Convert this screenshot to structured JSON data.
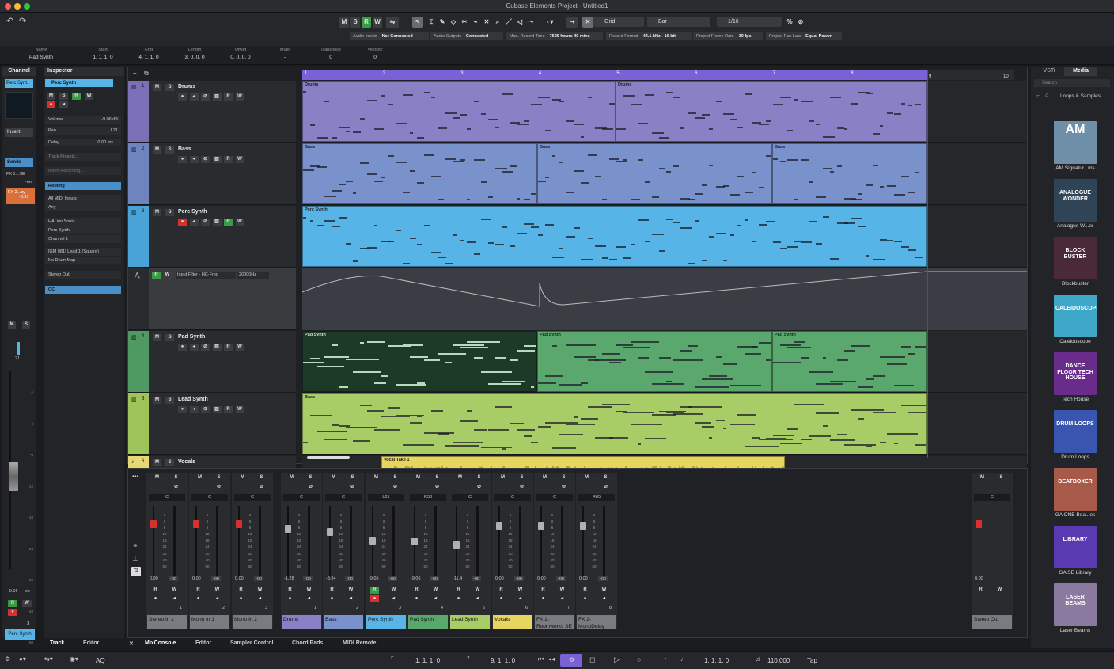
{
  "window": {
    "title": "Cubase Elements Project - Untitled1"
  },
  "toolbar": {
    "modes": [
      "M",
      "S",
      "R",
      "W"
    ],
    "grid_label": "Grid",
    "bar_label": "Bar",
    "quantize": "1/16",
    "status": [
      {
        "label": "Audio Inputs",
        "value": "Not Connected"
      },
      {
        "label": "Audio Outputs",
        "value": "Connected"
      },
      {
        "label": "Max. Record Time",
        "value": "7529 hours 49 mins"
      },
      {
        "label": "Record Format",
        "value": "44.1 kHz - 16 bit"
      },
      {
        "label": "Project Frame Rate",
        "value": "30 fps"
      },
      {
        "label": "Project Pan Law",
        "value": "Equal Power"
      }
    ]
  },
  "infoline": [
    {
      "label": "Name",
      "value": "Pad Synth"
    },
    {
      "label": "Start",
      "value": "1. 1. 1.   0"
    },
    {
      "label": "End",
      "value": "4. 1. 1.   0"
    },
    {
      "label": "Length",
      "value": "3. 0. 0.   0"
    },
    {
      "label": "Offset",
      "value": "0. 0. 0.   0"
    },
    {
      "label": "Mute",
      "value": "-"
    },
    {
      "label": "Transpose",
      "value": "0"
    },
    {
      "label": "Velocity",
      "value": "0"
    }
  ],
  "channel": {
    "title": "Channel",
    "name": "Perc Synt.",
    "insert": "Insert",
    "sends": "Sends",
    "send1": "FX 1...SE",
    "send1_val": "-oo",
    "send2": "FX 2...ay",
    "send2_val": "-8.31",
    "pan": "L21",
    "vol": "-9.06",
    "vol2": "-oo",
    "num": "3",
    "bottom_name": "Perc Synth",
    "scale": [
      "6",
      "0",
      "-6",
      "-12",
      "-18",
      "-24",
      "-30",
      "-40",
      "-50"
    ]
  },
  "inspector": {
    "title": "Inspector",
    "track": "Perc Synth",
    "volume_label": "Volume",
    "volume": "-9.06 dB",
    "pan_label": "Pan",
    "pan": "L21",
    "delay_label": "Delay",
    "delay": "0.00 ms",
    "presets": "Track Presets...",
    "insert_rec": "Insert Recording...",
    "routing": "Routing",
    "midi_in": "All MIDI Inputs",
    "any": "Any",
    "halion": "HALion Sonic",
    "perc": "Perc Synth",
    "chan": "Channel 1",
    "program": "[GM 081] Lead 1 (Square)",
    "drummap": "No Drum Map",
    "out": "Stereo Out",
    "qc": "QC"
  },
  "tracks": [
    {
      "num": "1",
      "name": "Drums",
      "color": "#7b70b8",
      "part_color": "#8a80c6",
      "parts": [
        {
          "label": "Drums"
        },
        {
          "label": "Drums"
        }
      ]
    },
    {
      "num": "2",
      "name": "Bass",
      "color": "#6d84be",
      "part_color": "#7a92cc",
      "parts": [
        {
          "label": "Bass"
        },
        {
          "label": "Bass"
        },
        {
          "label": "Bass"
        }
      ]
    },
    {
      "num": "3",
      "name": "Perc Synth",
      "color": "#4aa3d8",
      "part_color": "#56b4e6",
      "parts": [
        {
          "label": "Perc Synth"
        }
      ]
    },
    {
      "num": "4",
      "name": "Pad Synth",
      "color": "#4f9a62",
      "part_color": "#5aa86e",
      "parts": [
        {
          "label": "Pad Synth"
        },
        {
          "label": "Pad Synth"
        },
        {
          "label": "Pad Synth"
        }
      ]
    },
    {
      "num": "5",
      "name": "Lead Synth",
      "color": "#9ec45a",
      "part_color": "#a9cd66",
      "parts": [
        {
          "label": "Bass"
        }
      ]
    },
    {
      "num": "6",
      "name": "Vocals",
      "color": "#e8d874",
      "part_color": "#e6d660",
      "parts": [
        {
          "label": "Vocal Take 1"
        }
      ]
    }
  ],
  "automation": {
    "param": "Input Filter - HC-Freq",
    "value": "20000Hz"
  },
  "ruler": [
    "1",
    "2",
    "3",
    "4",
    "5",
    "6",
    "7",
    "8",
    "9",
    "10"
  ],
  "media": {
    "tabs": [
      "VSTi",
      "Media"
    ],
    "search": "Search",
    "path": "Loops & Samples",
    "items": [
      {
        "name": "AM Signatur...ms",
        "art": "AM",
        "color": "#6f8fa8"
      },
      {
        "name": "Analogue W...er",
        "art": "ANALOGUE WONDER",
        "color": "#2f4456"
      },
      {
        "name": "Blockbuster",
        "art": "BLOCK BUSTER",
        "color": "#4b2a38"
      },
      {
        "name": "Caleidoscope",
        "art": "CALEIDOSCOPE",
        "color": "#3fa8c8"
      },
      {
        "name": "Tech House",
        "art": "DANCE FLOOR TECH HOUSE",
        "color": "#6a2c8a"
      },
      {
        "name": "Drum Loops",
        "art": "DRUM LOOPS",
        "color": "#3a55b0"
      },
      {
        "name": "GA ONE Bea...es",
        "art": "BEATBOXER",
        "color": "#a85a4a"
      },
      {
        "name": "GA SE Library",
        "art": "LIBRARY",
        "color": "#5a3ab0"
      },
      {
        "name": "Laser Beams",
        "art": "LASER BEAMS",
        "color": "#8a7aa0"
      }
    ]
  },
  "mixer": {
    "scale": [
      "6",
      "0",
      "6",
      "12",
      "18",
      "24",
      "30",
      "40",
      "50"
    ],
    "channels": [
      {
        "name": "Stereo In 1",
        "num": "1",
        "pan": "C",
        "vol": "0.00",
        "color": "#7a7b80",
        "rec": true
      },
      {
        "name": "Mono In 1",
        "num": "2",
        "pan": "C",
        "vol": "0.00",
        "color": "#7a7b80",
        "rec": true
      },
      {
        "name": "Mono In 2",
        "num": "3",
        "pan": "C",
        "vol": "0.00",
        "color": "#7a7b80",
        "rec": true
      },
      {
        "name": "Drums",
        "num": "1",
        "pan": "C",
        "vol": "-1.28",
        "color": "#8a80c6",
        "rec": false
      },
      {
        "name": "Bass",
        "num": "2",
        "pan": "C",
        "vol": "-3.94",
        "color": "#7a92cc",
        "rec": false
      },
      {
        "name": "Perc Synth",
        "num": "3",
        "pan": "L21",
        "vol": "-9.06",
        "color": "#56b4e6",
        "rec": false
      },
      {
        "name": "Pad Synth",
        "num": "4",
        "pan": "R38",
        "vol": "-9.06",
        "color": "#5aa86e",
        "rec": false
      },
      {
        "name": "Lead Synth",
        "num": "5",
        "pan": "C",
        "vol": "-11.4",
        "color": "#a9cd66",
        "rec": false
      },
      {
        "name": "Vocals",
        "num": "6",
        "pan": "C",
        "vol": "0.00",
        "color": "#e6d660",
        "rec": false
      },
      {
        "name": "FX 1-Roomworks SE",
        "num": "7",
        "pan": "C",
        "vol": "0.00",
        "color": "#7a7b80",
        "rec": false
      },
      {
        "name": "FX 2-MonoDelay",
        "num": "8",
        "pan": "R65",
        "vol": "0.00",
        "color": "#7a7b80",
        "rec": false
      }
    ],
    "out": {
      "name": "Stereo Out",
      "pan": "C",
      "vol": "0.00"
    }
  },
  "tabs": {
    "left": [
      "Track",
      "Editor"
    ],
    "lower": [
      "MixConsole",
      "Editor",
      "Sampler Control",
      "Chord Pads",
      "MIDI Remote"
    ]
  },
  "transport": {
    "left_locator": "1. 1. 1.   0",
    "right_locator": "9. 1. 1.   0",
    "position": "1. 1. 1.   0",
    "tempo": "110.000",
    "tap": "Tap",
    "aq": "AQ"
  }
}
